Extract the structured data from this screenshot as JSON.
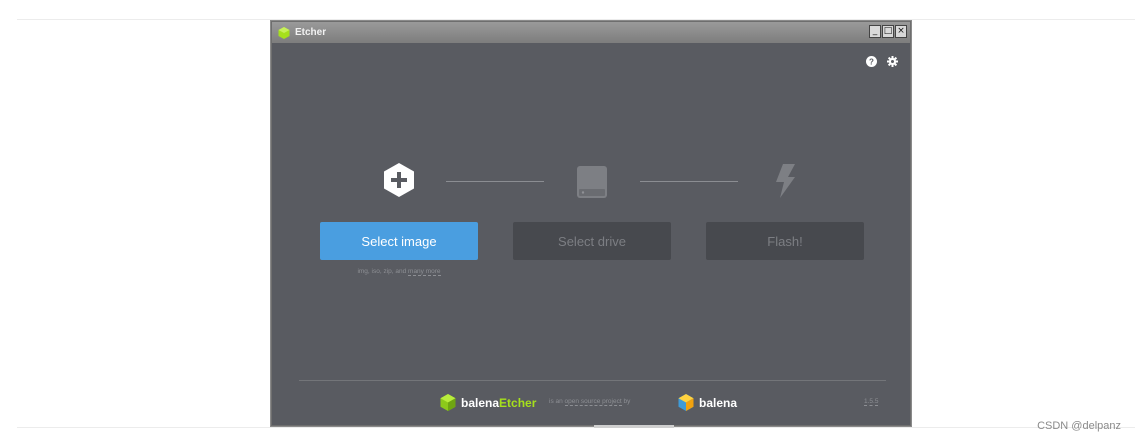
{
  "window": {
    "title": "Etcher",
    "controls": {
      "minimize": "_",
      "maximize": "□",
      "close": "×"
    }
  },
  "header_icons": [
    "help-icon",
    "settings-icon"
  ],
  "steps": {
    "image": {
      "icon": "plus-hexagon-icon",
      "button_label": "Select image",
      "formats_text": "img, iso, zip, and",
      "formats_more": "many more"
    },
    "drive": {
      "icon": "drive-icon",
      "button_label": "Select drive"
    },
    "flash": {
      "icon": "lightning-icon",
      "button_label": "Flash!"
    }
  },
  "footer": {
    "brand_prefix": "balena",
    "brand_suffix": "Etcher",
    "open_source_pre": "is an",
    "open_source_link": "open source project",
    "open_source_post": "by",
    "company": "balena",
    "version": "1.5.5"
  },
  "watermark": "CSDN @delpanz",
  "colors": {
    "accent": "#4a9ee0",
    "background": "#595b61",
    "etcher_green": "#a6e01c"
  }
}
